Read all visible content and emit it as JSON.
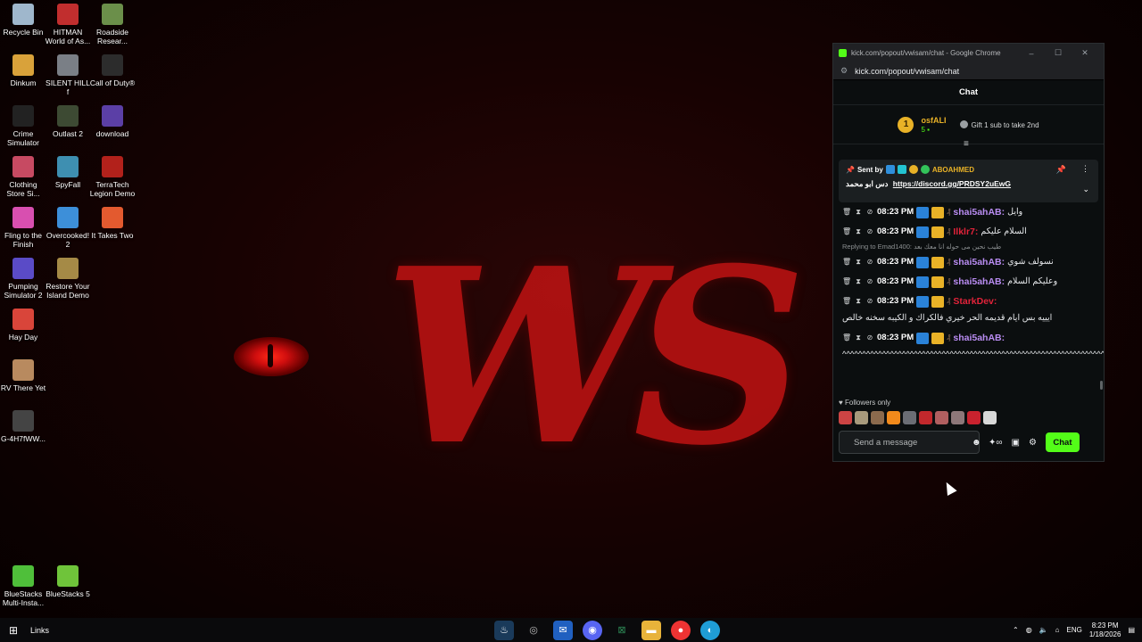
{
  "desktop": {
    "icons": [
      {
        "label": "Recycle Bin",
        "color": "#9fb7cc"
      },
      {
        "label": "HITMAN World of As...",
        "color": "#c12e2e"
      },
      {
        "label": "Roadside Resear...",
        "color": "#6b8f4a"
      },
      {
        "label": "Dinkum",
        "color": "#d9a23a"
      },
      {
        "label": "SILENT HILL f",
        "color": "#7a7f86"
      },
      {
        "label": "Call of Duty®",
        "color": "#2c2c2c"
      },
      {
        "label": "Crime Simulator",
        "color": "#222"
      },
      {
        "label": "Outlast 2",
        "color": "#3d4a33"
      },
      {
        "label": "download",
        "color": "#5b3fa6"
      },
      {
        "label": "Clothing Store Si...",
        "color": "#c74a62"
      },
      {
        "label": "SpyFall",
        "color": "#3e8fb1"
      },
      {
        "label": "TerraTech Legion Demo",
        "color": "#b2211b"
      },
      {
        "label": "Fling to the Finish",
        "color": "#d84fb0"
      },
      {
        "label": "Overcooked! 2",
        "color": "#3d8fd9"
      },
      {
        "label": "It Takes Two",
        "color": "#e35a2f"
      },
      {
        "label": "Pumping Simulator 2",
        "color": "#5a4bc7"
      },
      {
        "label": "Restore Your Island Demo",
        "color": "#a58a46"
      },
      {
        "label": "Hay Day",
        "color": "#d9453a"
      },
      {
        "label": "RV There Yet",
        "color": "#b88a5f"
      },
      {
        "label": "G-4H7fWW...",
        "color": "#444"
      },
      {
        "label": "BlueStacks Multi-Insta...",
        "color": "#4fbf3a"
      },
      {
        "label": "BlueStacks 5",
        "color": "#6fc43a"
      }
    ],
    "wallpaper_text": "WS"
  },
  "browser": {
    "title": "kick.com/popout/vwisam/chat - Google Chrome",
    "url": "kick.com/popout/vwisam/chat"
  },
  "chat": {
    "header": "Chat",
    "leader": {
      "rank": "1",
      "name": "osfALI",
      "count": "5",
      "gift_text": "Gift 1 sub to take 2nd"
    },
    "pinned": {
      "sent_by_label": "Sent by",
      "sender": "ABOAHMED",
      "message_prefix": "دس ابو محمد",
      "link": "https://discord.gg/PRDSY2uEwG"
    },
    "messages": [
      {
        "time": "08:23 PM",
        "user": "shai5ahAB:",
        "user_color": "#b98cf2",
        "text": "وايل"
      },
      {
        "time": "08:23 PM",
        "user": "Ilklr7:",
        "user_color": "#e2233a",
        "text": "السلام عليكم"
      },
      {
        "time": "08:23 PM",
        "user": "shai5ahAB:",
        "user_color": "#b98cf2",
        "text": "نسولف شوي",
        "reply": "Replying to Emad1400: طيب نحين مى حوله انا معك بعد"
      },
      {
        "time": "08:23 PM",
        "user": "shai5ahAB:",
        "user_color": "#b98cf2",
        "text": "وعليكم السلام"
      },
      {
        "time": "08:23 PM",
        "user": "StarkDev:",
        "user_color": "#e2233a",
        "text": "ايييه بس ايام قديمه الحر خيري فالكراك و الكيبه سخنه خالص"
      },
      {
        "time": "08:23 PM",
        "user": "shai5ahAB:",
        "user_color": "#b98cf2",
        "text": "^^^^^^^^^^^^^^^^^^^^^^^^^^^^^^^^^^^^^^^^^^^^^^^^^^^^^^^^^^^^^^^^^^^^^^^^^^^^^^^^^^^^^^^^^^^^^^^^^^^^^^^^^^^^^^^^^^^^^^^^"
      }
    ],
    "followers_label": "Followers only",
    "composer": {
      "placeholder": "Send a message",
      "send_label": "Chat"
    }
  },
  "taskbar": {
    "links_label": "Links",
    "language": "ENG",
    "time": "8:23 PM",
    "date": "1/18/2026"
  },
  "colors": {
    "kick_green": "#53fc18",
    "gold": "#e9b227"
  }
}
